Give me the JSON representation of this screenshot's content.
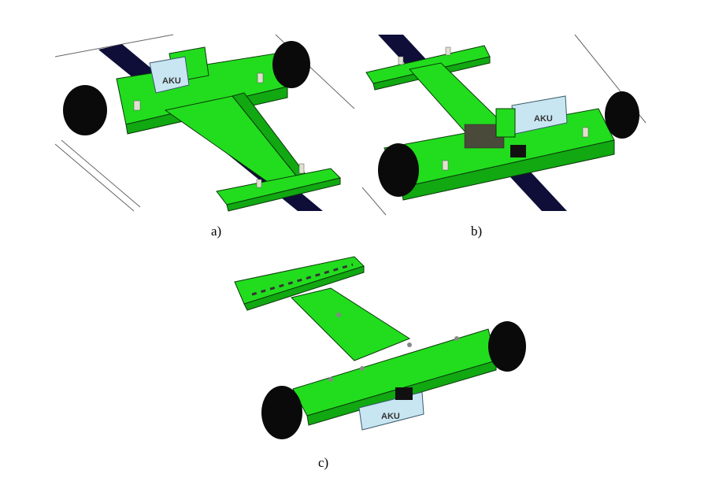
{
  "figure": {
    "panels": [
      {
        "caption": "a)",
        "box_label": "AKU"
      },
      {
        "caption": "b)",
        "box_label": "AKU"
      },
      {
        "caption": "c)",
        "box_label": "AKU"
      }
    ],
    "colors": {
      "body_green": "#22dd1e",
      "body_green_dark": "#11a812",
      "body_green_shadow": "#0d7f10",
      "wheel": "#0a0a0a",
      "track": "#0e0e38",
      "battery": "#c8e6f2",
      "outline": "#0a3a0a"
    }
  }
}
